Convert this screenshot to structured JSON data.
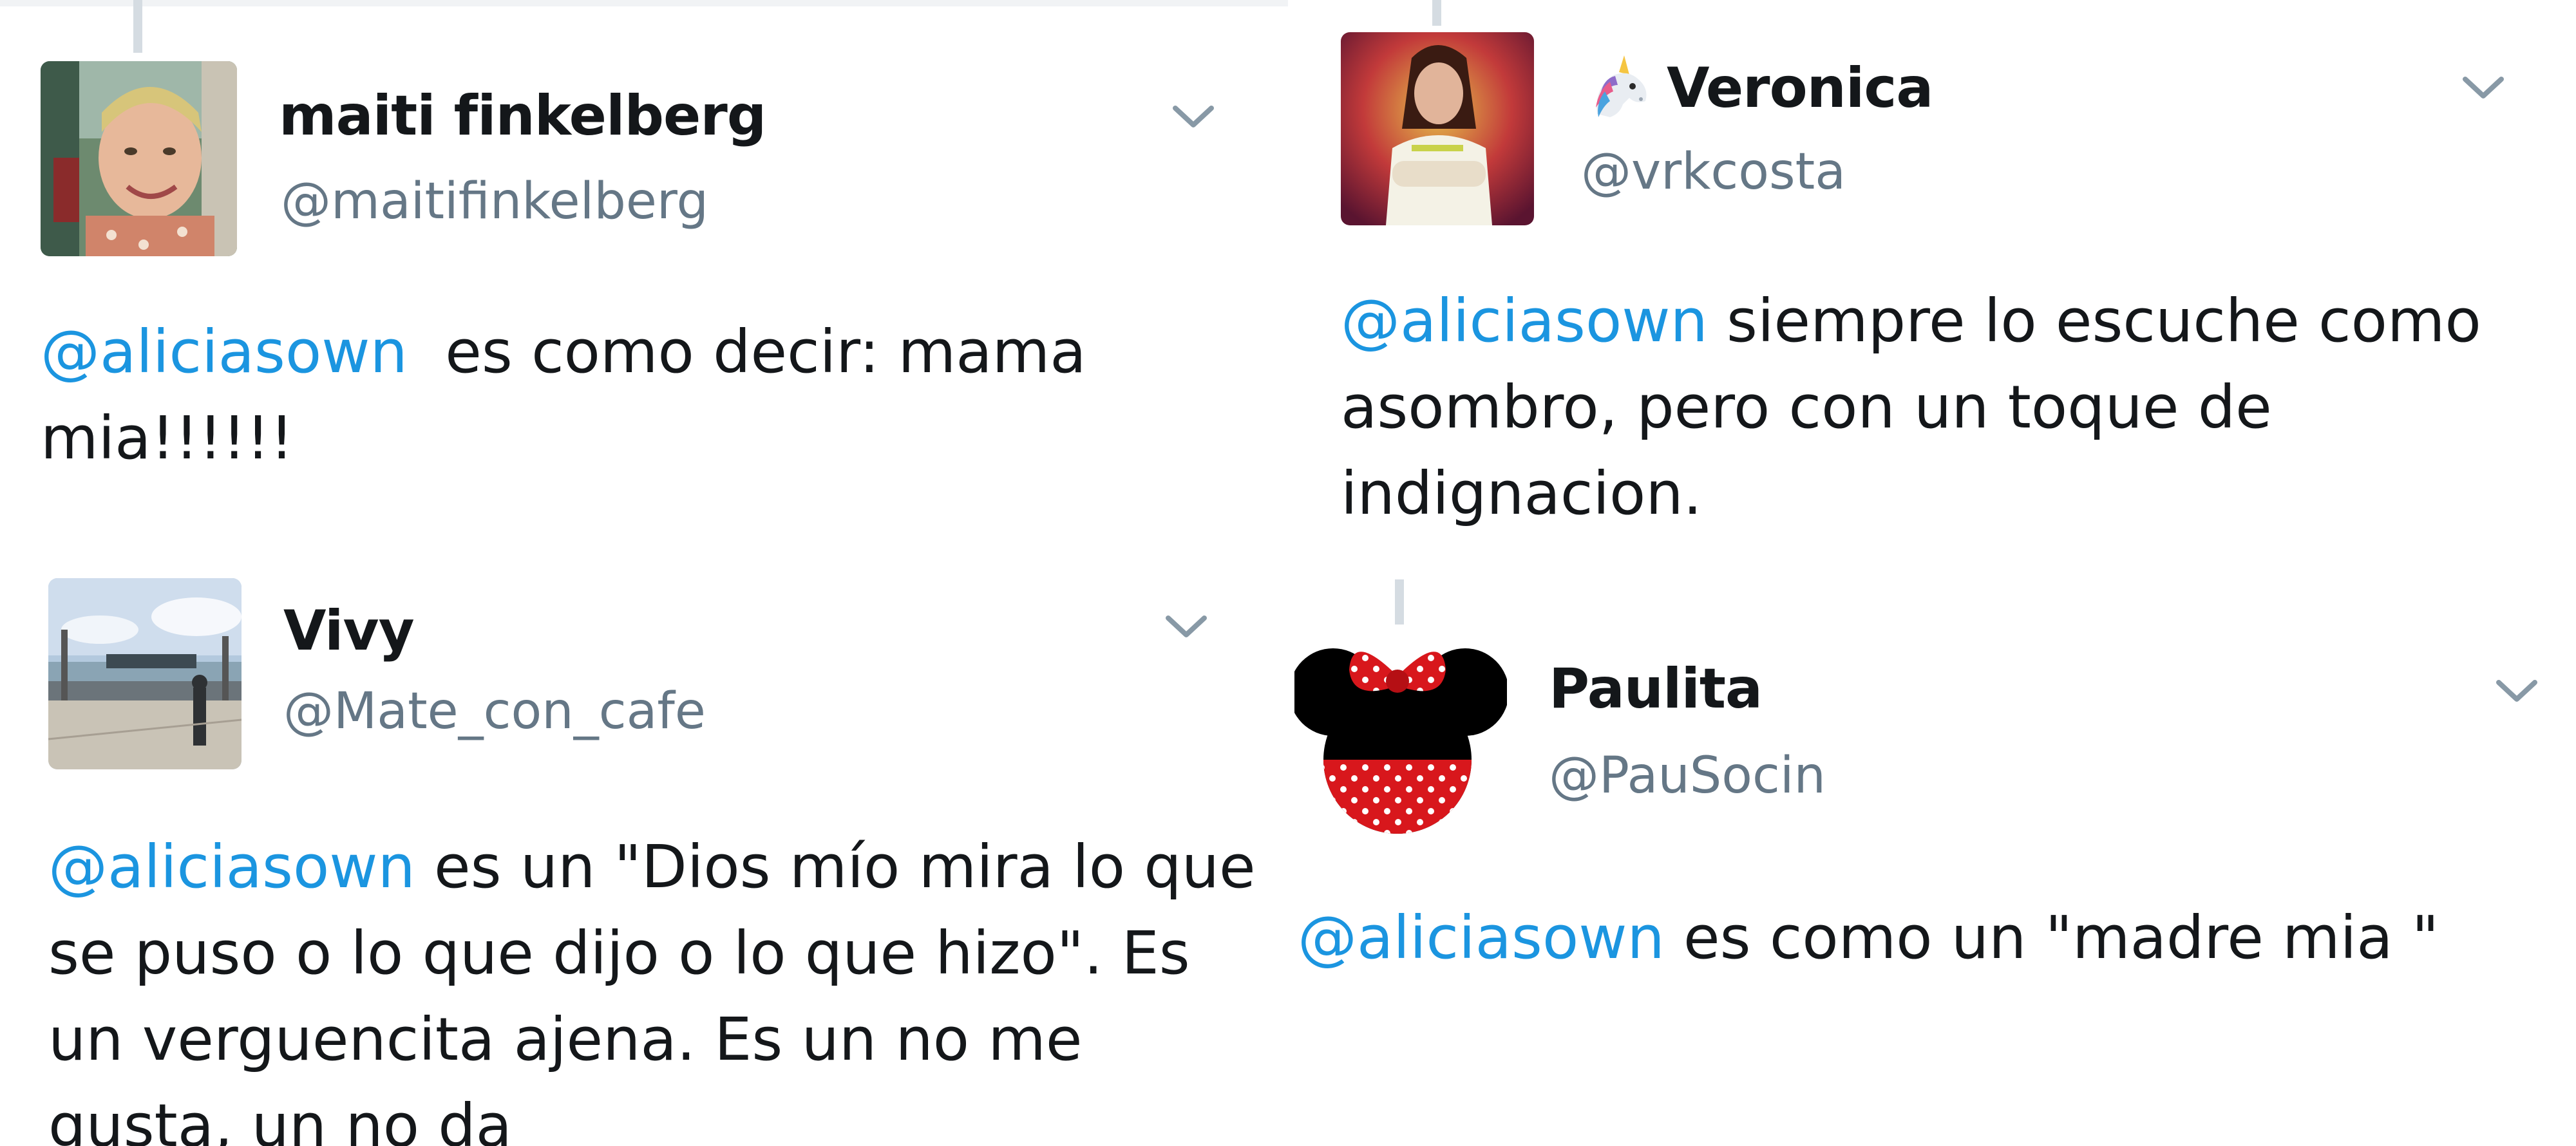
{
  "tweets": [
    {
      "display_name": "maiti finkelberg",
      "handle": "@maitifinkelberg",
      "mention": "@aliciasown",
      "text": "  es como decir: mama mia!!!!!!"
    },
    {
      "display_name": "Vivy",
      "handle": "@Mate_con_cafe",
      "mention": "@aliciasown",
      "text": " es un \"Dios mío mira lo que se puso o lo que dijo o lo que hizo\". Es un verguencita ajena. Es un no me gusta, un no da"
    },
    {
      "display_name": "Veronica",
      "display_emoji": "unicorn-emoji",
      "handle": "@vrkcosta",
      "mention": "@aliciasown",
      "text": " siempre lo escuche como asombro, pero con un toque de indignacion."
    },
    {
      "display_name": "Paulita",
      "handle": "@PauSocin",
      "mention": "@aliciasown",
      "text": " es como un \"madre mia \""
    }
  ],
  "colors": {
    "mention": "#1b95e0",
    "handle": "#657786",
    "text": "#14171a",
    "chevron": "#8899a6",
    "thread_line": "#d5dce2"
  },
  "icons": {
    "chevron": "chevron-down-icon"
  }
}
